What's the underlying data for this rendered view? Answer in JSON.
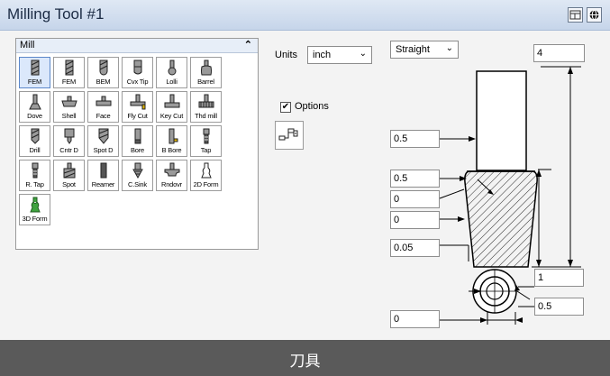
{
  "window": {
    "title": "Milling Tool #1"
  },
  "titlebar_buttons": [
    {
      "icon": "layout-icon"
    },
    {
      "icon": "globe-icon"
    }
  ],
  "mill_panel": {
    "label": "Mill",
    "collapse_icon": "chevron-up-icon",
    "tools": [
      {
        "label": "FEM",
        "icon": "flat-endmill-icon",
        "selected": true
      },
      {
        "label": "FEM",
        "icon": "flat-endmill-2-icon"
      },
      {
        "label": "BEM",
        "icon": "ball-endmill-icon"
      },
      {
        "label": "Cvx Tip",
        "icon": "convex-tip-icon"
      },
      {
        "label": "Lolli",
        "icon": "lollipop-icon"
      },
      {
        "label": "Barrel",
        "icon": "barrel-icon"
      },
      {
        "label": "Dove",
        "icon": "dovetail-icon"
      },
      {
        "label": "Shell",
        "icon": "shell-mill-icon"
      },
      {
        "label": "Face",
        "icon": "face-mill-icon"
      },
      {
        "label": "Fly Cut",
        "icon": "fly-cutter-icon"
      },
      {
        "label": "Key Cut",
        "icon": "key-cutter-icon"
      },
      {
        "label": "Thd mill",
        "icon": "thread-mill-icon"
      },
      {
        "label": "Drill",
        "icon": "drill-icon"
      },
      {
        "label": "Cntr D",
        "icon": "center-drill-icon"
      },
      {
        "label": "Spot D",
        "icon": "spot-drill-icon"
      },
      {
        "label": "Bore",
        "icon": "bore-icon"
      },
      {
        "label": "B Bore",
        "icon": "back-bore-icon"
      },
      {
        "label": "Tap",
        "icon": "tap-icon"
      },
      {
        "label": "R. Tap",
        "icon": "rigid-tap-icon"
      },
      {
        "label": "Spot",
        "icon": "spot-icon"
      },
      {
        "label": "Reamer",
        "icon": "reamer-icon"
      },
      {
        "label": "C.Sink",
        "icon": "countersink-icon"
      },
      {
        "label": "Rndovr",
        "icon": "roundover-icon"
      },
      {
        "label": "2D Form",
        "icon": "2d-form-icon"
      },
      {
        "label": "3D Form",
        "icon": "3d-form-icon"
      }
    ]
  },
  "units": {
    "label": "Units",
    "value": "inch"
  },
  "options": {
    "label": "Options",
    "checked": true
  },
  "profile": {
    "value": "Straight"
  },
  "fields": {
    "total_length": "4",
    "shank_diameter": "0.5",
    "flute_diameter": "0.5",
    "taper_angle": "0",
    "corner_radius": "0",
    "tip_value": "0.05",
    "flute_length": "1",
    "bottom_diameter": "0.5",
    "tip_offset": "0"
  },
  "footer": {
    "text": "刀具"
  },
  "colors": {
    "titlebar": "#c6d5ea",
    "panel_bg": "#f3f3f3",
    "footer": "#5a5a5a",
    "selected": "#dbe8fb"
  }
}
